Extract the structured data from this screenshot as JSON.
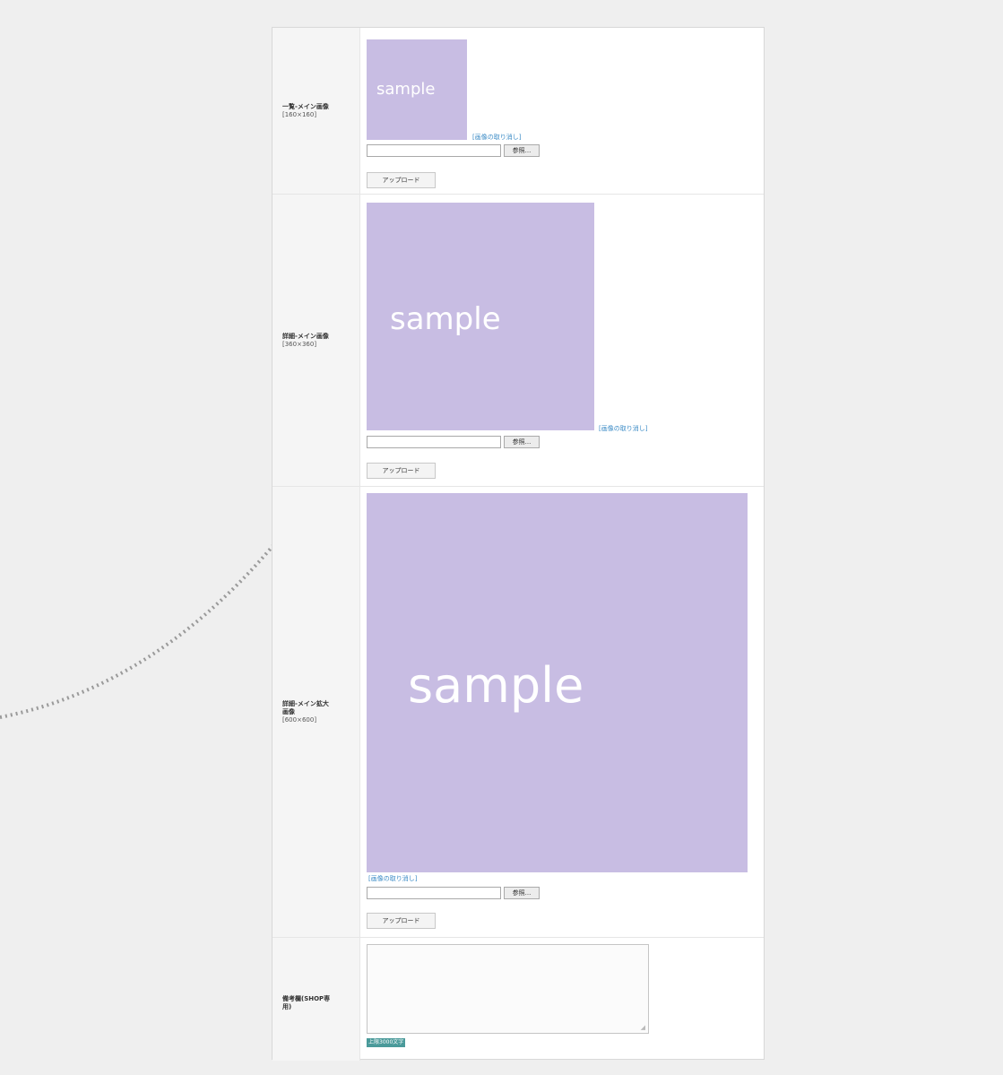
{
  "sample_text": "sample",
  "colors": {
    "sample_bg": "#c8bde3",
    "link": "#3b8bc6",
    "badge": "#4a9a9a"
  },
  "download_link": "[画像の取り消し]",
  "browse_label": "参照...",
  "upload_label": "アップロード",
  "rows": [
    {
      "label": "一覧-メイン画像",
      "size": "[160×160]"
    },
    {
      "label": "詳細-メイン画像",
      "size": "[360×360]"
    },
    {
      "label": "詳細-メイン拡大\n画像",
      "size": "[600×600]"
    },
    {
      "label": "備考欄(SHOP専\n用)",
      "size": ""
    }
  ],
  "note_limit": "上限3000文字",
  "decoration": {
    "arrow_style": "dotted-gray-curve"
  }
}
